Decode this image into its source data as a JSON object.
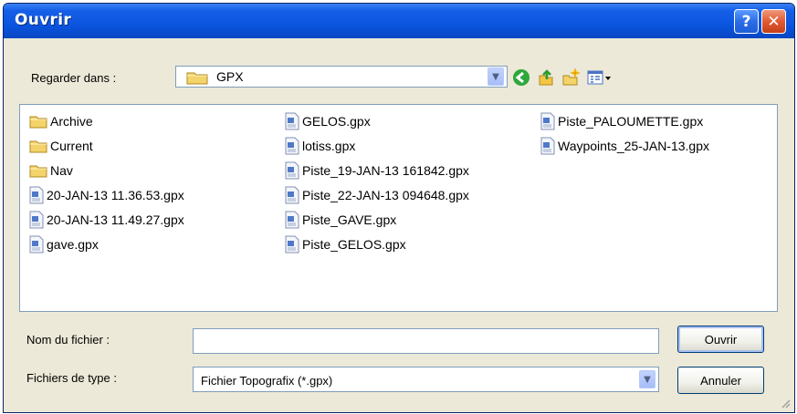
{
  "dialog": {
    "title": "Ouvrir",
    "help_glyph": "?",
    "close_glyph": "✕"
  },
  "look_in": {
    "label": "Regarder dans :",
    "value": "GPX"
  },
  "toolbar": {
    "icons": [
      "back-icon",
      "up-folder-icon",
      "new-folder-icon",
      "view-menu-icon"
    ]
  },
  "files": {
    "col1": [
      "Archive",
      "Current",
      "Nav",
      "20-JAN-13 11.36.53.gpx",
      "20-JAN-13 11.49.27.gpx",
      "gave.gpx"
    ],
    "col2": [
      "GELOS.gpx",
      "lotiss.gpx",
      "Piste_19-JAN-13 161842.gpx",
      "Piste_22-JAN-13 094648.gpx",
      "Piste_GAVE.gpx",
      "Piste_GELOS.gpx"
    ],
    "col3": [
      "Piste_PALOUMETTE.gpx",
      "Waypoints_25-JAN-13.gpx"
    ]
  },
  "filename": {
    "label": "Nom du fichier :",
    "value": ""
  },
  "filetype": {
    "label": "Fichiers de type :",
    "value": "Fichier Topografix (*.gpx)"
  },
  "buttons": {
    "open": "Ouvrir",
    "cancel": "Annuler"
  },
  "colors": {
    "titlebar": "#0b55e0",
    "dialog_bg": "#ece9d8",
    "border": "#7f9db9"
  }
}
